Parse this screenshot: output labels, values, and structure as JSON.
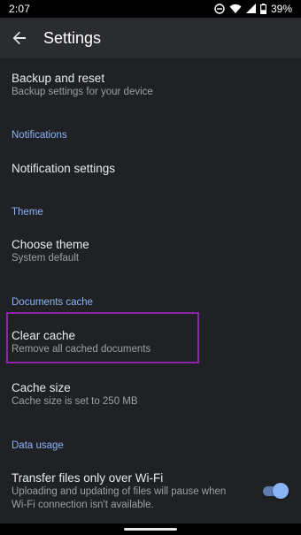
{
  "status_bar": {
    "time": "2:07",
    "battery": "39%",
    "icons": [
      "do-not-disturb-icon",
      "wifi-icon",
      "signal-icon",
      "battery-icon"
    ]
  },
  "app_bar": {
    "title": "Settings",
    "back_icon": "arrow-back-icon"
  },
  "settings": {
    "backup": {
      "title": "Backup and reset",
      "subtitle": "Backup settings for your device"
    },
    "notifications_header": "Notifications",
    "notification_settings": {
      "title": "Notification settings"
    },
    "theme_header": "Theme",
    "choose_theme": {
      "title": "Choose theme",
      "subtitle": "System default"
    },
    "documents_cache_header": "Documents cache",
    "clear_cache": {
      "title": "Clear cache",
      "subtitle": "Remove all cached documents"
    },
    "cache_size": {
      "title": "Cache size",
      "subtitle": "Cache size is set to 250 MB"
    },
    "data_usage_header": "Data usage",
    "wifi_only": {
      "title": "Transfer files only over Wi-Fi",
      "subtitle_line1": "Uploading and updating of files will pause when",
      "subtitle_line2": "Wi-Fi connection isn't available.",
      "enabled": true
    }
  },
  "colors": {
    "background": "#202124",
    "app_bar": "#2b2c30",
    "accent": "#8ab4f8",
    "highlight": "#8e24aa"
  }
}
